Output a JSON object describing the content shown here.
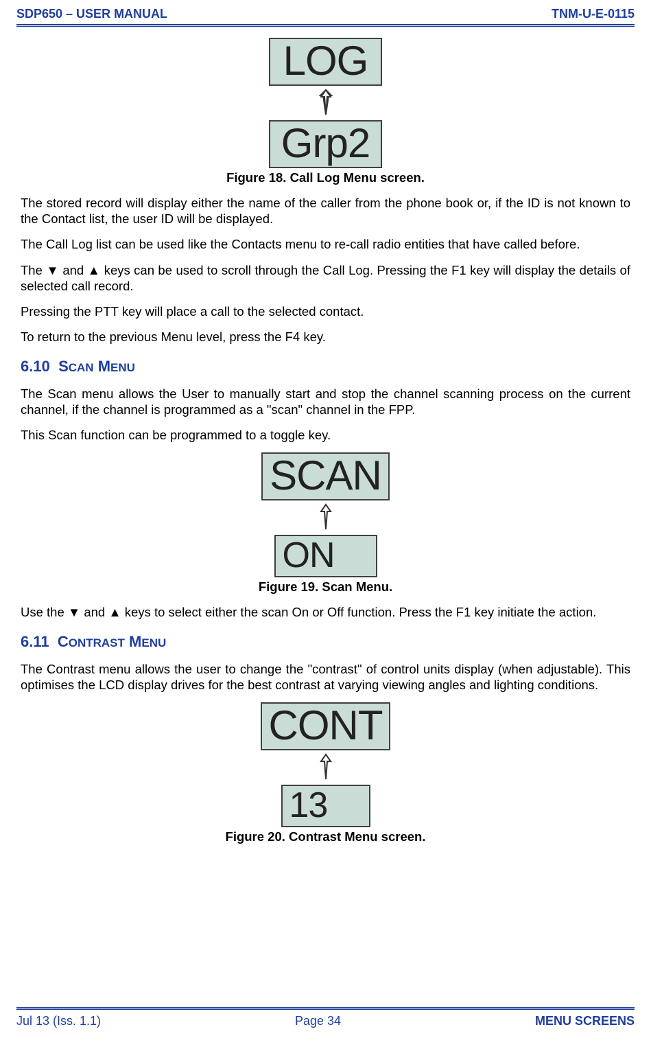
{
  "header": {
    "left": "SDP650 – USER MANUAL",
    "right": "TNM-U-E-0115"
  },
  "fig18": {
    "top_label": "LOG",
    "bottom_label": "Grp2",
    "caption": "Figure 18.  Call Log Menu screen."
  },
  "para_store": "The stored record will display either the name of the caller from the phone book or, if the ID is not known to the Contact list, the user ID will be displayed.",
  "para_calllog": "The Call Log list can be used like the Contacts menu to re-call radio entities that have called before.",
  "para_keys": "The ▼ and ▲ keys can be used to scroll through the Call Log.  Pressing the F1 key will display the details of selected call record.",
  "para_ptt": "Pressing the PTT key will place a call to the selected contact.",
  "para_return": "To return to the previous Menu level, press the F4 key.",
  "section_scan": {
    "num": "6.10",
    "w1a": "S",
    "w1b": "CAN",
    "w2a": "M",
    "w2b": "ENU"
  },
  "para_scan1": "The Scan menu allows the User to manually start and stop the channel scanning process on the current channel, if the channel is programmed as a \"scan\" channel in the FPP.",
  "para_scan2": "This Scan function can be programmed to a toggle key.",
  "fig19": {
    "top_label": "SCAN",
    "bottom_label": "ON",
    "caption": "Figure 19.  Scan Menu."
  },
  "para_scan3": "Use the ▼ and ▲ keys to select either the scan On or Off function.  Press the F1 key initiate the action.",
  "section_contrast": {
    "num": "6.11",
    "w1a": "C",
    "w1b": "ONTRAST",
    "w2a": "M",
    "w2b": "ENU"
  },
  "para_contrast": "The Contrast menu allows the user to change the \"contrast\" of control units display (when adjustable).  This optimises the LCD display drives for the best contrast at varying viewing angles and lighting conditions.",
  "fig20": {
    "top_label": "CONT",
    "bottom_label": "13",
    "caption": "Figure 20.  Contrast Menu screen."
  },
  "footer": {
    "left": "Jul 13 (Iss. 1.1)",
    "center": "Page 34",
    "right": "MENU SCREENS"
  }
}
